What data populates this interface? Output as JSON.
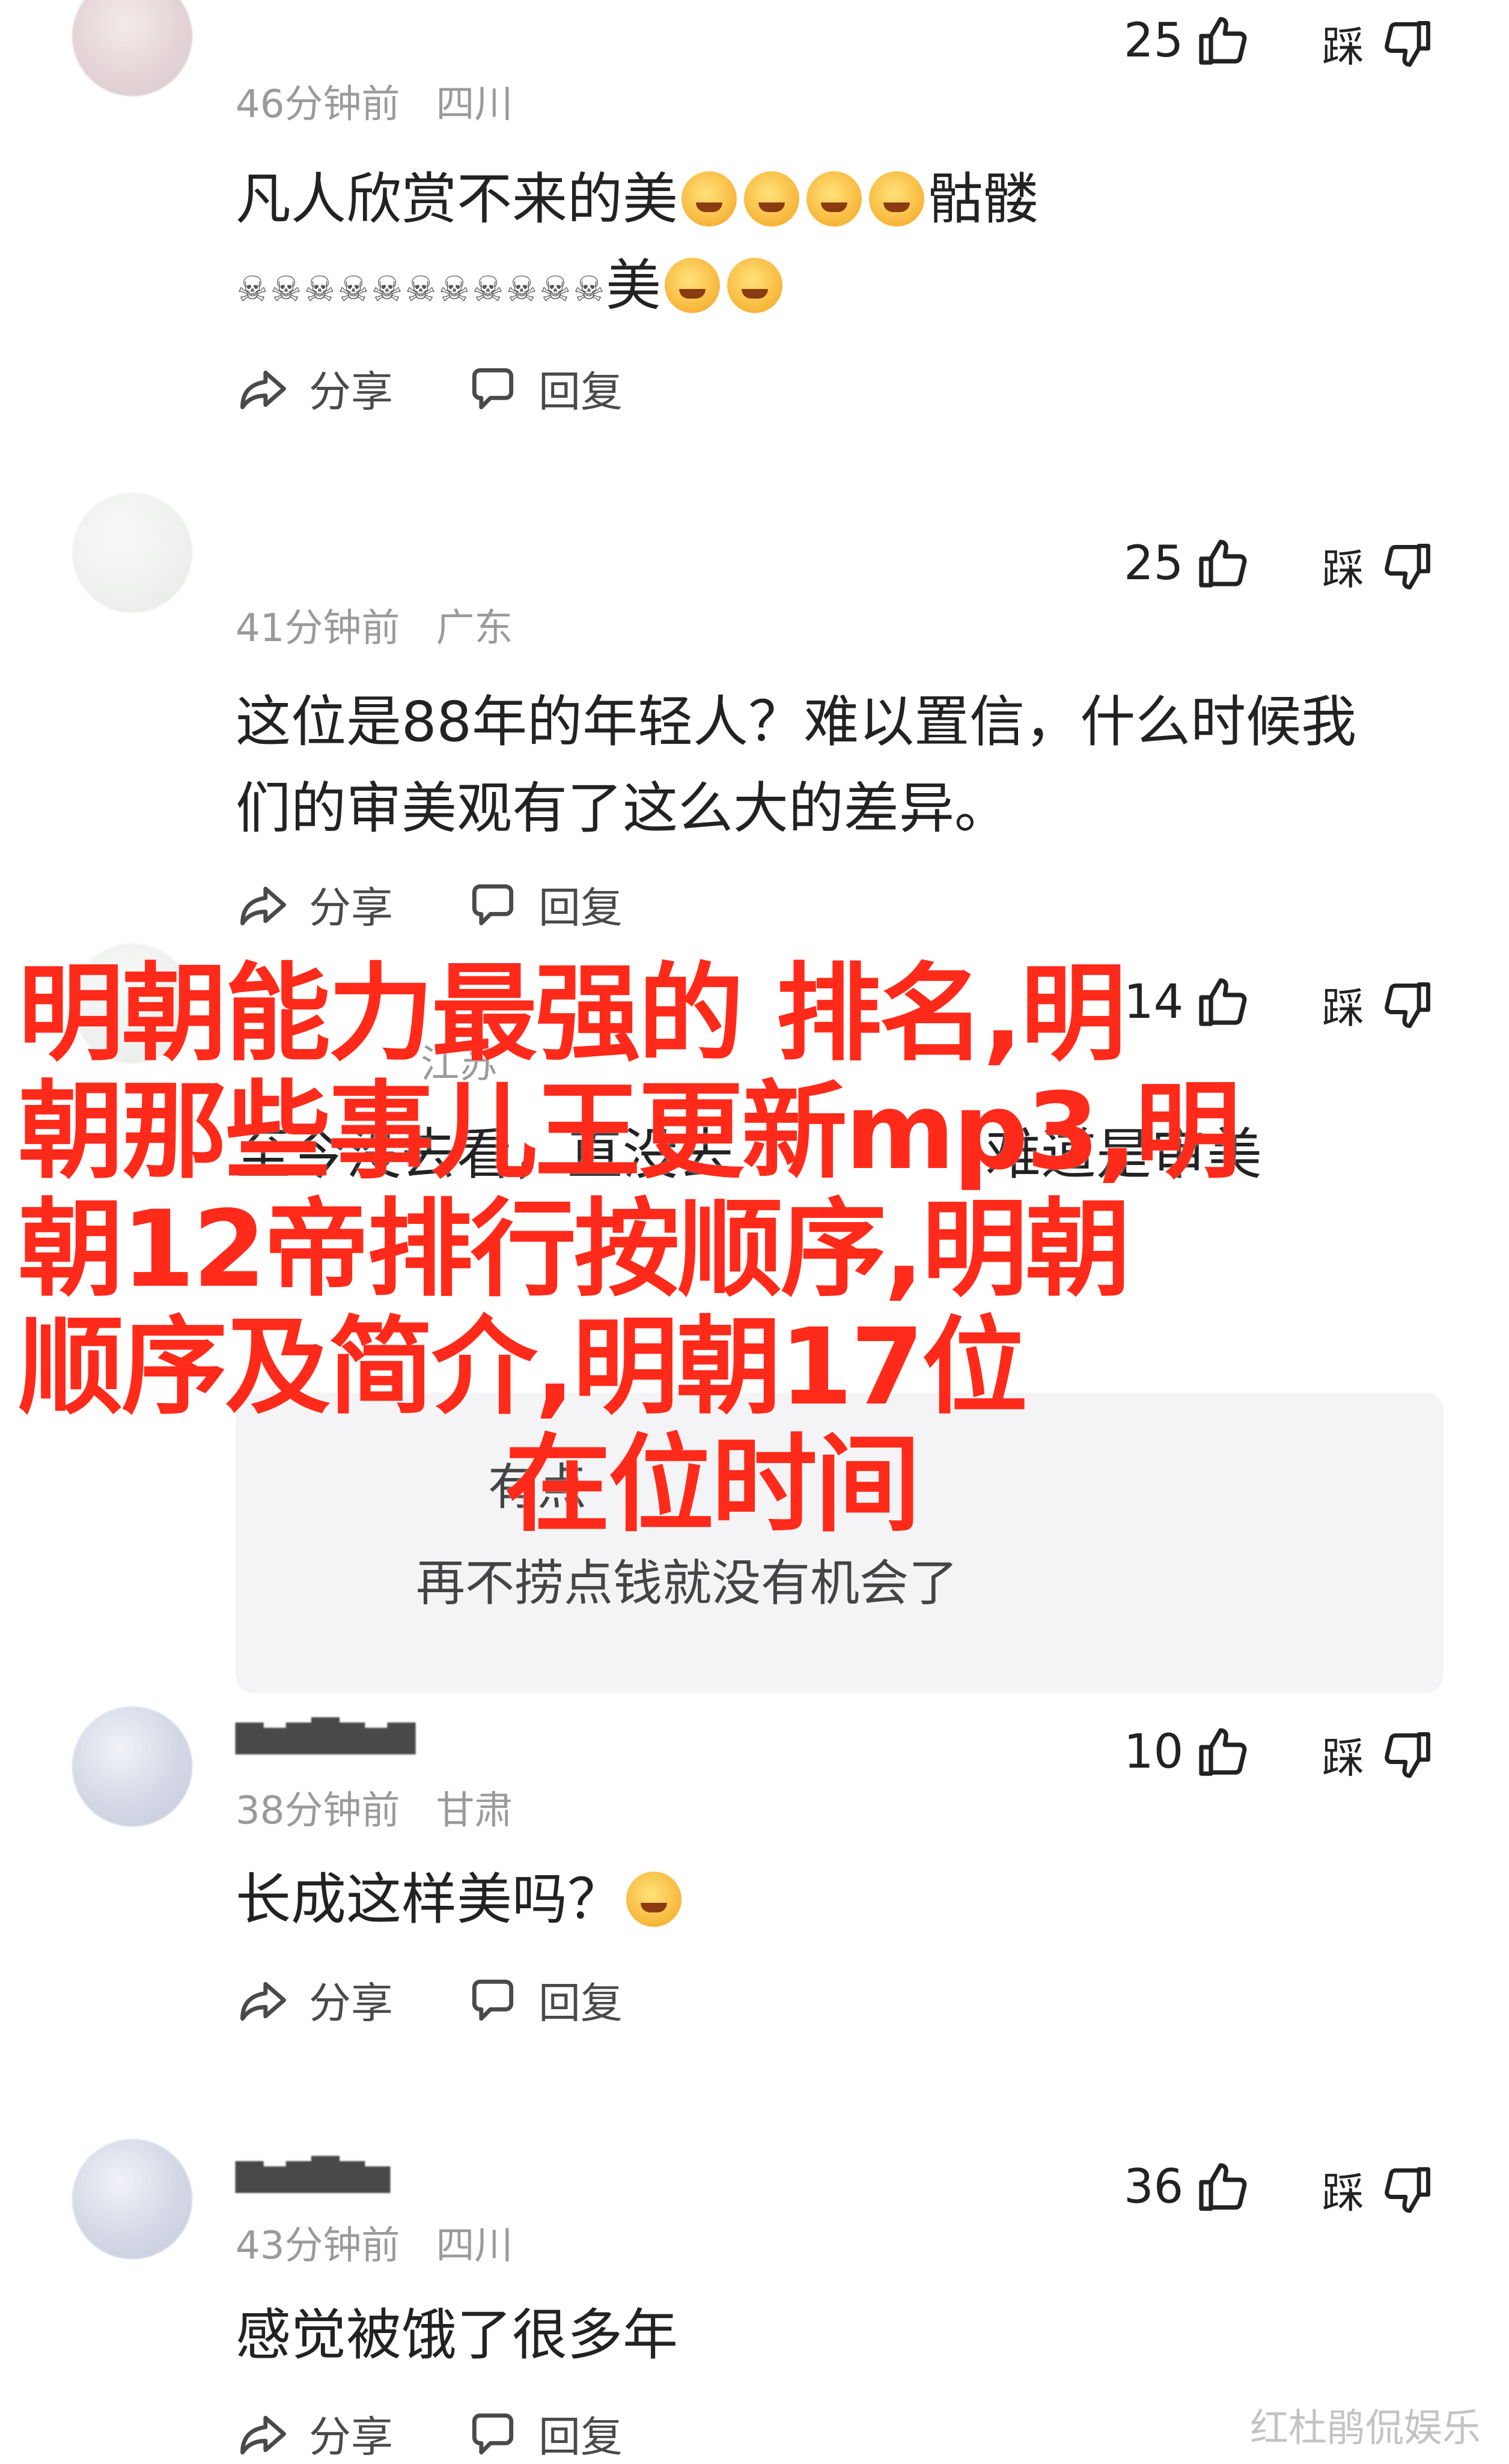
{
  "labels": {
    "share": "分享",
    "reply": "回复",
    "dislike": "踩"
  },
  "comments": [
    {
      "time": "46分钟前",
      "region": "四川",
      "likes": "25",
      "line1": "凡人欣赏不来的美",
      "line1_tail": "骷髅",
      "line2_tail": "美"
    },
    {
      "time": "41分钟前",
      "region": "广东",
      "likes": "25",
      "line1": "这位是88年的年轻人？难以置信，什么时候我",
      "line2": "们的审美观有了这么大的差异。"
    },
    {
      "time": "",
      "region": "江苏",
      "likes": "14",
      "line1": "至今没去看，直没去",
      "line1_end": "难道是审美",
      "reply_a": "有点",
      "reply_b": "再不捞点钱就没有机会了"
    },
    {
      "time": "38分钟前",
      "region": "甘肃",
      "likes": "10",
      "line1": "长成这样美吗？"
    },
    {
      "time": "43分钟前",
      "region": "四川",
      "likes": "36",
      "line1": "感觉被饿了很多年"
    }
  ],
  "overlay": {
    "line1": "明朝能力最强的  排名,明",
    "line2": "朝那些事儿王更新mp3,明",
    "line3": "朝12帝排行按顺序,明朝",
    "line4": " 顺序及简介,明朝17位",
    "line5": "在位时间"
  },
  "watermark": "红杜鹃侃娱乐"
}
